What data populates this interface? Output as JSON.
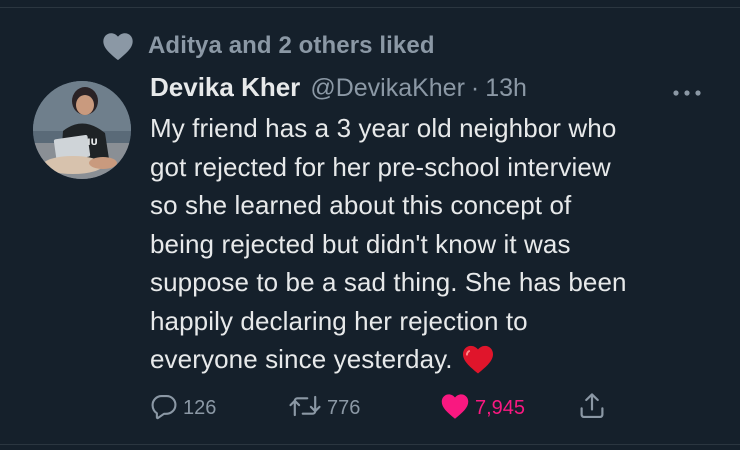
{
  "social_context": {
    "icon": "heart-icon",
    "text": "Aditya and 2 others liked"
  },
  "tweet": {
    "avatar": "avatar",
    "author_name": "Devika Kher",
    "author_handle": "@DevikaKher",
    "separator": "·",
    "time": "13h",
    "more_icon": "more-icon",
    "text_lines": [
      "My friend has a 3 year old neighbor who",
      "got rejected for her pre-school interview",
      "so she learned about this concept of",
      "being rejected but didn't know it was",
      "suppose to be a sad thing. She has been",
      "happily declaring her rejection to",
      "everyone since yesterday."
    ],
    "emoji": "red-heart-emoji"
  },
  "actions": {
    "reply": {
      "icon": "reply-icon",
      "count": "126"
    },
    "retweet": {
      "icon": "retweet-icon",
      "count": "776"
    },
    "like": {
      "icon": "heart-icon",
      "count": "7,945",
      "active": true
    },
    "share": {
      "icon": "share-icon"
    }
  },
  "colors": {
    "background": "#15202b",
    "primary_text": "#e7e9ea",
    "secondary_text": "#8b98a5",
    "like_active": "#f91880"
  }
}
